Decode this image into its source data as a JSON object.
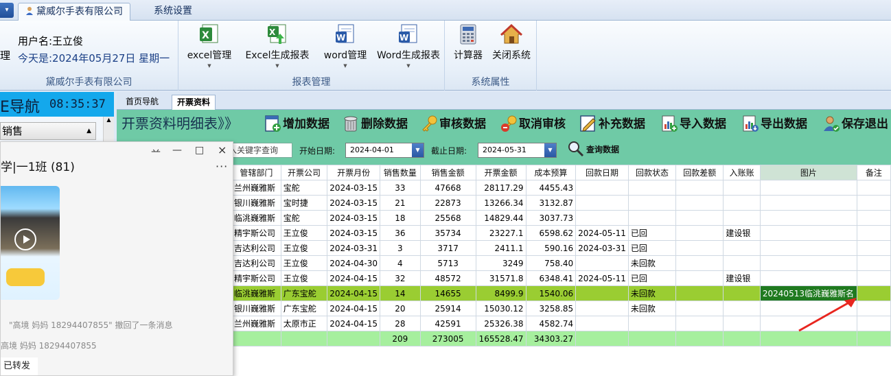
{
  "tabs": {
    "app_button": "▾",
    "company_tab": "黛威尔手表有限公司",
    "settings_tab": "系统设置"
  },
  "ribbon": {
    "left_cut_label": "理",
    "user_name": "用户名:王立俊",
    "today": "今天是:2024年05月27日  星期一",
    "company_group_label": "黛威尔手表有限公司",
    "report_group_label": "报表管理",
    "system_group_label": "系统属性",
    "buttons": {
      "excel_manage": "excel管理",
      "excel_report": "Excel生成报表",
      "word_manage": "word管理",
      "word_report": "Word生成报表",
      "calculator": "计算器",
      "close_system": "关闭系统"
    }
  },
  "nav": {
    "title": "E导航",
    "time": "08:35:37",
    "section": "销售"
  },
  "chat": {
    "pin": "䒑",
    "minimize": "—",
    "maximize": "□",
    "close": "×",
    "title": "学|一1班 (81)",
    "more": "···",
    "msg1": "\"高境 妈妈  18294407855\" 撤回了一条消息",
    "msg2": "高境 妈妈  18294407855",
    "forwarded": "已转发"
  },
  "content_tabs": {
    "home": "首页导航",
    "invoice": "开票资料"
  },
  "toolbar": {
    "title": "开票资料明细表》》",
    "add": "增加数据",
    "delete": "删除数据",
    "audit": "审核数据",
    "cancel_audit": "取消审核",
    "supplement": "补充数据",
    "import": "导入数据",
    "export": "导出数据",
    "save_exit": "保存退出"
  },
  "filter": {
    "keyword_placeholder": "入关键字查询",
    "start_label": "开始日期:",
    "start_date": "2024-04-01",
    "end_label": "截止日期:",
    "end_date": "2024-05-31",
    "query": "查询数据"
  },
  "grid": {
    "columns": [
      "管辖部门",
      "开票公司",
      "开票月份",
      "销售数量",
      "销售金额",
      "开票金额",
      "成本预算",
      "回款日期",
      "回款状态",
      "回款差额",
      "入账账",
      "图片",
      "备注"
    ],
    "rows": [
      [
        "兰州巍雅斯",
        "宝舵",
        "2024-03-15",
        "33",
        "47668",
        "28117.29",
        "4455.43",
        "",
        "",
        "",
        "",
        "",
        ""
      ],
      [
        "银川巍雅斯",
        "宝时捷",
        "2024-03-15",
        "21",
        "22873",
        "13266.34",
        "3132.87",
        "",
        "",
        "",
        "",
        "",
        ""
      ],
      [
        "临洮巍雅斯",
        "宝舵",
        "2024-03-15",
        "18",
        "25568",
        "14829.44",
        "3037.73",
        "",
        "",
        "",
        "",
        "",
        ""
      ],
      [
        "精宇斯公司",
        "王立俊",
        "2024-03-15",
        "36",
        "35734",
        "23227.1",
        "6598.62",
        "2024-05-11",
        "已回",
        "",
        "建设银",
        "",
        ""
      ],
      [
        "吉达利公司",
        "王立俊",
        "2024-03-31",
        "3",
        "3717",
        "2411.1",
        "590.16",
        "2024-03-31",
        "已回",
        "",
        "",
        "",
        ""
      ],
      [
        "吉达利公司",
        "王立俊",
        "2024-04-30",
        "4",
        "5713",
        "3249",
        "758.40",
        "",
        "未回款",
        "",
        "",
        "",
        ""
      ],
      [
        "精宇斯公司",
        "王立俊",
        "2024-04-15",
        "32",
        "48572",
        "31571.8",
        "6348.41",
        "2024-05-11",
        "已回",
        "",
        "建设银",
        "",
        ""
      ],
      [
        "临洮巍雅斯",
        "广东宝舵",
        "2024-04-15",
        "14",
        "14655",
        "8499.9",
        "1540.06",
        "",
        "未回款",
        "",
        "",
        "20240513临洮巍雅斯名",
        ""
      ],
      [
        "银川巍雅斯",
        "广东宝舵",
        "2024-04-15",
        "20",
        "25914",
        "15030.12",
        "3258.85",
        "",
        "未回款",
        "",
        "",
        "",
        ""
      ],
      [
        "兰州巍雅斯",
        "太原市正",
        "2024-04-15",
        "28",
        "42591",
        "25326.38",
        "4582.74",
        "",
        "",
        "",
        "",
        "",
        ""
      ]
    ],
    "selected_row": 7,
    "totals": [
      "",
      "",
      "",
      "209",
      "273005",
      "165528.47",
      "34303.27",
      "",
      "",
      "",
      "",
      "",
      ""
    ]
  },
  "colors": {
    "toolbar_green": "#6fcaa6",
    "selected_row": "#9acd32",
    "total_row": "#a6ef9e",
    "nav_blue": "#14a8ec",
    "annotation_arrow": "#e8261f"
  }
}
